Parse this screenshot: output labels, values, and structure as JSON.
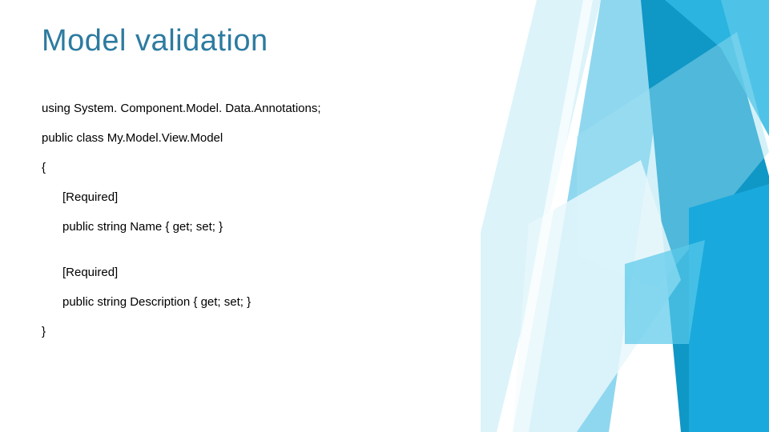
{
  "title": "Model validation",
  "code": {
    "l1": "using System. Component.Model. Data.Annotations;",
    "l2": "public class My.Model.View.Model",
    "l3": "{",
    "l4": "[Required]",
    "l5": "public string Name { get; set; }",
    "l6": "[Required]",
    "l7": "public string Description { get; set; }",
    "l8": "}"
  }
}
